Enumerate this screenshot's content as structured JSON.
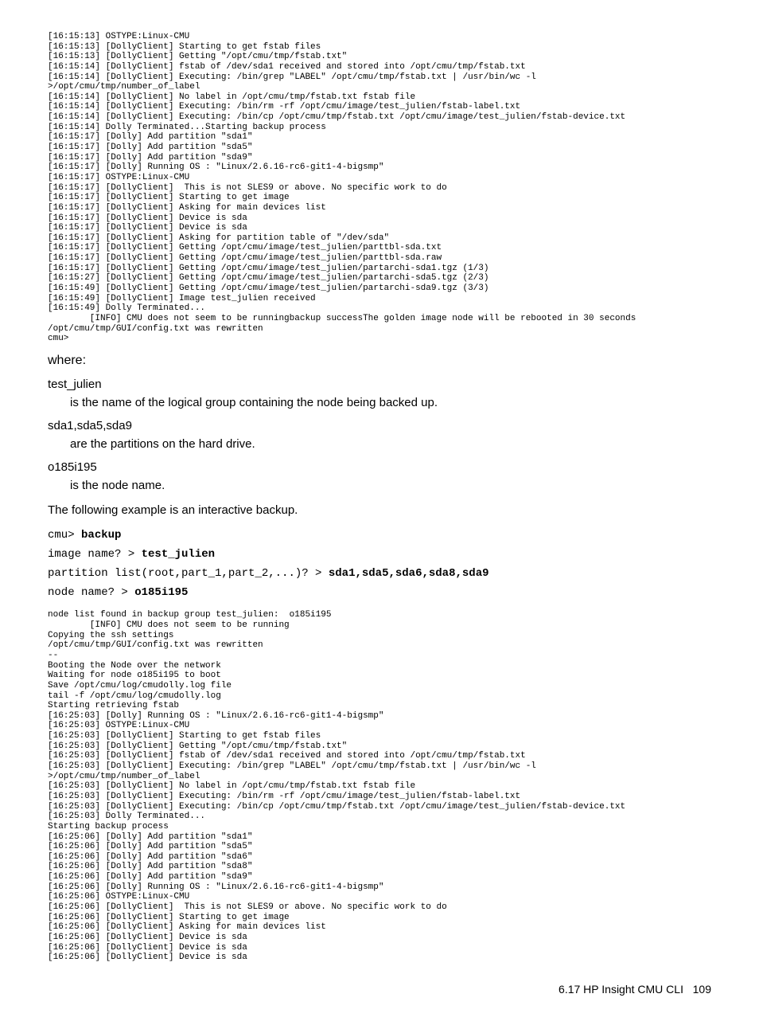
{
  "log1": "[16:15:13] OSTYPE:Linux-CMU\n[16:15:13] [DollyClient] Starting to get fstab files\n[16:15:13] [DollyClient] Getting \"/opt/cmu/tmp/fstab.txt\"\n[16:15:14] [DollyClient] fstab of /dev/sda1 received and stored into /opt/cmu/tmp/fstab.txt\n[16:15:14] [DollyClient] Executing: /bin/grep \"LABEL\" /opt/cmu/tmp/fstab.txt | /usr/bin/wc -l\n>/opt/cmu/tmp/number_of_label\n[16:15:14] [DollyClient] No label in /opt/cmu/tmp/fstab.txt fstab file\n[16:15:14] [DollyClient] Executing: /bin/rm -rf /opt/cmu/image/test_julien/fstab-label.txt\n[16:15:14] [DollyClient] Executing: /bin/cp /opt/cmu/tmp/fstab.txt /opt/cmu/image/test_julien/fstab-device.txt\n[16:15:14] Dolly Terminated...Starting backup process\n[16:15:17] [Dolly] Add partition \"sda1\"\n[16:15:17] [Dolly] Add partition \"sda5\"\n[16:15:17] [Dolly] Add partition \"sda9\"\n[16:15:17] [Dolly] Running OS : \"Linux/2.6.16-rc6-git1-4-bigsmp\"\n[16:15:17] OSTYPE:Linux-CMU\n[16:15:17] [DollyClient]  This is not SLES9 or above. No specific work to do\n[16:15:17] [DollyClient] Starting to get image\n[16:15:17] [DollyClient] Asking for main devices list\n[16:15:17] [DollyClient] Device is sda\n[16:15:17] [DollyClient] Device is sda\n[16:15:17] [DollyClient] Asking for partition table of \"/dev/sda\"\n[16:15:17] [DollyClient] Getting /opt/cmu/image/test_julien/parttbl-sda.txt\n[16:15:17] [DollyClient] Getting /opt/cmu/image/test_julien/parttbl-sda.raw\n[16:15:17] [DollyClient] Getting /opt/cmu/image/test_julien/partarchi-sda1.tgz (1/3)\n[16:15:27] [DollyClient] Getting /opt/cmu/image/test_julien/partarchi-sda5.tgz (2/3)\n[16:15:49] [DollyClient] Getting /opt/cmu/image/test_julien/partarchi-sda9.tgz (3/3)\n[16:15:49] [DollyClient] Image test_julien received\n[16:15:49] Dolly Terminated...\n        [INFO] CMU does not seem to be runningbackup successThe golden image node will be rebooted in 30 seconds\n/opt/cmu/tmp/GUI/config.txt was rewritten\ncmu>",
  "where": "where:",
  "defs": [
    {
      "term": "test_julien",
      "def": "is the name of the logical group containing the node being backed up."
    },
    {
      "term": "sda1,sda5,sda9",
      "def": "are the partitions on the hard drive."
    },
    {
      "term": "o185i195",
      "def": "is the node name."
    }
  ],
  "para1": "The following example is an interactive backup.",
  "interactive": {
    "l1a": "cmu> ",
    "l1b": "backup",
    "l2a": "image name? > ",
    "l2b": "test_julien",
    "l3a": "partition list(root,part_1,part_2,...)? > ",
    "l3b": "sda1,sda5,sda6,sda8,sda9",
    "l4a": "node name? > ",
    "l4b": "o185i195"
  },
  "log2": "node list found in backup group test_julien:  o185i195\n        [INFO] CMU does not seem to be running\nCopying the ssh settings\n/opt/cmu/tmp/GUI/config.txt was rewritten\n--\nBooting the Node over the network\nWaiting for node o185i195 to boot\nSave /opt/cmu/log/cmudolly.log file\ntail -f /opt/cmu/log/cmudolly.log\nStarting retrieving fstab\n[16:25:03] [Dolly] Running OS : \"Linux/2.6.16-rc6-git1-4-bigsmp\"\n[16:25:03] OSTYPE:Linux-CMU\n[16:25:03] [DollyClient] Starting to get fstab files\n[16:25:03] [DollyClient] Getting \"/opt/cmu/tmp/fstab.txt\"\n[16:25:03] [DollyClient] fstab of /dev/sda1 received and stored into /opt/cmu/tmp/fstab.txt\n[16:25:03] [DollyClient] Executing: /bin/grep \"LABEL\" /opt/cmu/tmp/fstab.txt | /usr/bin/wc -l\n>/opt/cmu/tmp/number_of_label\n[16:25:03] [DollyClient] No label in /opt/cmu/tmp/fstab.txt fstab file\n[16:25:03] [DollyClient] Executing: /bin/rm -rf /opt/cmu/image/test_julien/fstab-label.txt\n[16:25:03] [DollyClient] Executing: /bin/cp /opt/cmu/tmp/fstab.txt /opt/cmu/image/test_julien/fstab-device.txt\n[16:25:03] Dolly Terminated...\nStarting backup process\n[16:25:06] [Dolly] Add partition \"sda1\"\n[16:25:06] [Dolly] Add partition \"sda5\"\n[16:25:06] [Dolly] Add partition \"sda6\"\n[16:25:06] [Dolly] Add partition \"sda8\"\n[16:25:06] [Dolly] Add partition \"sda9\"\n[16:25:06] [Dolly] Running OS : \"Linux/2.6.16-rc6-git1-4-bigsmp\"\n[16:25:06] OSTYPE:Linux-CMU\n[16:25:06] [DollyClient]  This is not SLES9 or above. No specific work to do\n[16:25:06] [DollyClient] Starting to get image\n[16:25:06] [DollyClient] Asking for main devices list\n[16:25:06] [DollyClient] Device is sda\n[16:25:06] [DollyClient] Device is sda\n[16:25:06] [DollyClient] Device is sda",
  "footer": {
    "section": "6.17 HP Insight CMU CLI",
    "page": "109"
  }
}
